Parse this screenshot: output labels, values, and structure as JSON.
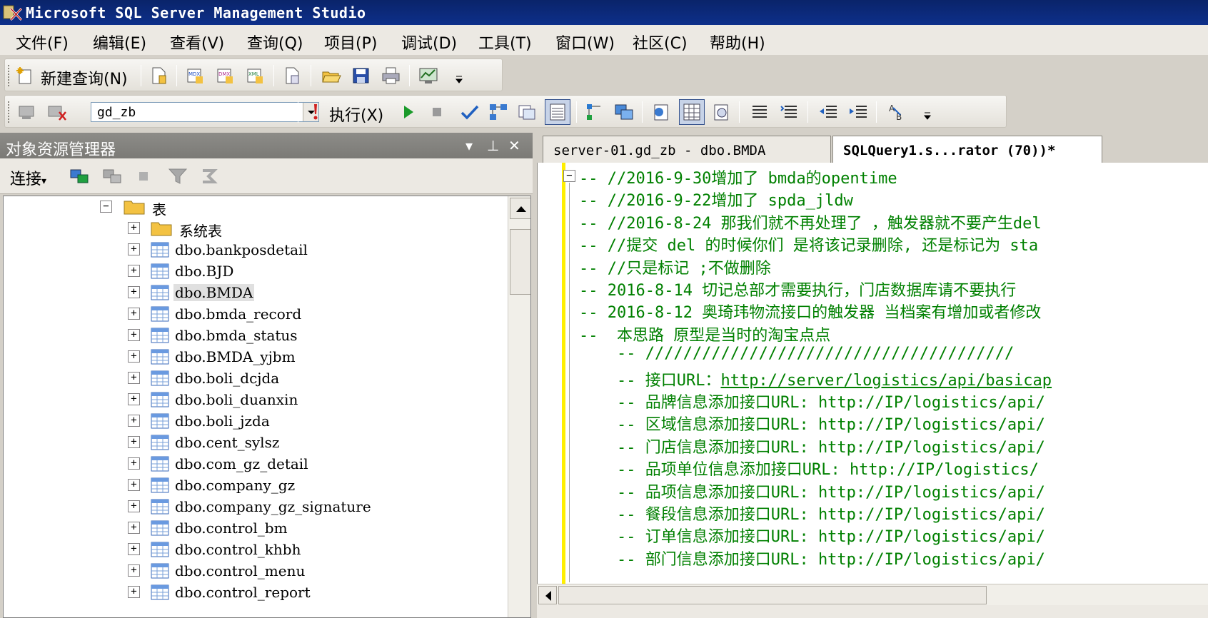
{
  "window": {
    "title": "Microsoft SQL Server Management Studio"
  },
  "menu": {
    "items": [
      "文件(F)",
      "编辑(E)",
      "查看(V)",
      "查询(Q)",
      "项目(P)",
      "调试(D)",
      "工具(T)",
      "窗口(W)",
      "社区(C)",
      "帮助(H)"
    ]
  },
  "toolbar1": {
    "new_query_label": "新建查询(N)"
  },
  "toolbar2": {
    "database": "gd_zb",
    "execute_label": "执行(X)"
  },
  "object_explorer": {
    "title": "对象资源管理器",
    "connect_label": "连接",
    "tree": {
      "tables_label": "表",
      "system_tables_label": "系统表",
      "items": [
        "dbo.bankposdetail",
        "dbo.BJD",
        "dbo.BMDA",
        "dbo.bmda_record",
        "dbo.bmda_status",
        "dbo.BMDA_yjbm",
        "dbo.boli_dcjda",
        "dbo.boli_duanxin",
        "dbo.boli_jzda",
        "dbo.cent_sylsz",
        "dbo.com_gz_detail",
        "dbo.company_gz",
        "dbo.company_gz_signature",
        "dbo.control_bm",
        "dbo.control_khbh",
        "dbo.control_menu",
        "dbo.control_report"
      ],
      "selected_item": "dbo.BMDA"
    }
  },
  "editor": {
    "tabs": [
      "server-01.gd_zb - dbo.BMDA",
      "SQLQuery1.s...rator (70))*"
    ],
    "active_tab": 1,
    "lines": [
      "-- //2016-9-30增加了 bmda的opentime",
      "-- //2016-9-22增加了 spda_jldw",
      "-- //2016-8-24 那我们就不再处理了 ，触发器就不要产生del",
      "-- //提交 del 的时候你们 是将该记录删除, 还是标记为 sta",
      "-- //只是标记 ;不做删除",
      "-- 2016-8-14 切记总部才需要执行，门店数据库请不要执行",
      "-- 2016-8-12 奥琦玮物流接口的触发器 当档案有增加或者修改",
      "--  本思路 原型是当时的淘宝点点",
      "    -- ///////////////////////////////////////",
      "    -- 接口URL：",
      "    -- 品牌信息添加接口URL: http://IP/logistics/api/",
      "    -- 区域信息添加接口URL: http://IP/logistics/api/",
      "    -- 门店信息添加接口URL: http://IP/logistics/api/",
      "    -- 品项单位信息添加接口URL: http://IP/logistics/",
      "    -- 品项信息添加接口URL: http://IP/logistics/api/",
      "    -- 餐段信息添加接口URL: http://IP/logistics/api/",
      "    -- 订单信息添加接口URL: http://IP/logistics/api/",
      "    -- 部门信息添加接口URL: http://IP/logistics/api/"
    ],
    "url_link": "http://server/logistics/api/basicap"
  },
  "colors": {
    "titlebar": "#0a246a",
    "comment": "#008000",
    "gutter_change": "#ffef00"
  }
}
